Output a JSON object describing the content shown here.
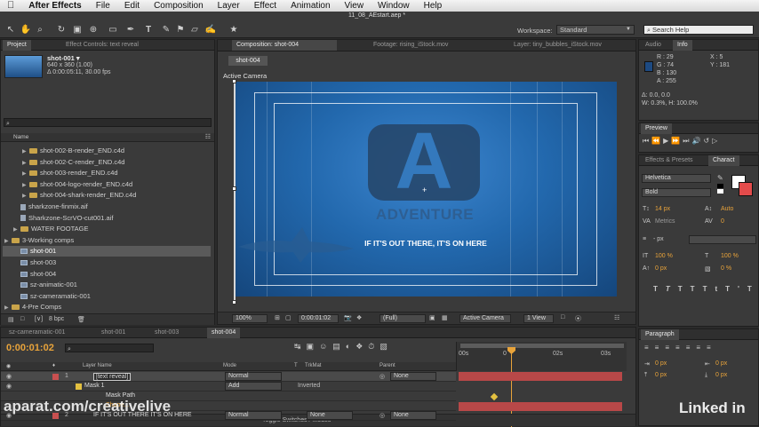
{
  "menubar": {
    "app_name": "After Effects",
    "items": [
      "File",
      "Edit",
      "Composition",
      "Layer",
      "Effect",
      "Animation",
      "View",
      "Window",
      "Help"
    ]
  },
  "toolbar": {
    "file_title": "11_08_AEstart.aep *",
    "workspace_label": "Workspace:",
    "workspace_value": "Standard",
    "search_placeholder": "Search Help"
  },
  "project": {
    "tab_project": "Project",
    "tab_effect_controls": "Effect Controls: text reveal",
    "selected_name": "shot-001 ▾",
    "selected_size": "640 x 360 (1.00)",
    "selected_duration": "Δ 0:00:05:11, 30.00 fps",
    "column_name": "Name",
    "items": [
      {
        "name": "shot-002-B-render_END.c4d",
        "type": "folder",
        "indent": 2
      },
      {
        "name": "shot-002-C-render_END.c4d",
        "type": "folder",
        "indent": 2
      },
      {
        "name": "shot-003-render_END.c4d",
        "type": "folder",
        "indent": 2
      },
      {
        "name": "shot-004-logo-render_END.c4d",
        "type": "folder",
        "indent": 2
      },
      {
        "name": "shot-004-shark-render_END.c4d",
        "type": "folder",
        "indent": 2
      },
      {
        "name": "sharkzone-finmix.aif",
        "type": "file",
        "indent": 1
      },
      {
        "name": "Sharkzone-ScrVO-cut001.aif",
        "type": "file",
        "indent": 1
      },
      {
        "name": "WATER FOOTAGE",
        "type": "folder",
        "indent": 1
      },
      {
        "name": "3-Working comps",
        "type": "folder",
        "indent": 0
      },
      {
        "name": "shot-001",
        "type": "comp",
        "indent": 1,
        "selected": true
      },
      {
        "name": "shot-003",
        "type": "comp",
        "indent": 1
      },
      {
        "name": "shot-004",
        "type": "comp",
        "indent": 1
      },
      {
        "name": "sz-animatic-001",
        "type": "comp",
        "indent": 1
      },
      {
        "name": "sz-cameramatic-001",
        "type": "comp",
        "indent": 1
      },
      {
        "name": "4-Pre Comps",
        "type": "folder",
        "indent": 0
      }
    ],
    "bpc": "8 bpc"
  },
  "composition": {
    "tab_comp": "Composition: shot-004",
    "tab_footage": "Footage: rising_iStock.mov",
    "tab_layer": "Layer: tiny_bubbles_iStock.mov",
    "subtab": "shot-004",
    "camera_label": "Active Camera",
    "logo_letter": "A",
    "brand_text": "ADVENTURE",
    "tagline": "IF IT'S OUT THERE, IT'S ON HERE",
    "zoom": "100%",
    "timecode": "0:00:01:02",
    "resolution": "(Full)",
    "camera_dropdown": "Active Camera",
    "view_dropdown": "1 View"
  },
  "info": {
    "tab_audio": "Audio",
    "tab_info": "Info",
    "r": "R : 29",
    "g": "G : 74",
    "b": "B : 130",
    "a": "A : 255",
    "x": "X : 5",
    "y": "Y : 181",
    "delta1": "Δ: 0.0, 0.0",
    "delta2": "W: 0.3%, H: 100.0%",
    "sample_color": "#1d4a82"
  },
  "preview": {
    "tab": "Preview"
  },
  "character": {
    "tab_effects": "Effects & Presets",
    "tab_character": "Charact",
    "font": "Helvetica",
    "style": "Bold",
    "size": "14 px",
    "leading": "Auto",
    "kerning": "Metrics",
    "tracking": "0",
    "stroke": "- px",
    "vscale": "100 %",
    "hscale": "100 %",
    "baseline": "0 px",
    "tsume": "0 %",
    "accent_color": "#e8a33a"
  },
  "paragraph": {
    "tab": "Paragraph",
    "indent_left": "0 px",
    "indent_right": "0 px",
    "space_before": "0 px",
    "space_after": "0 px"
  },
  "timeline": {
    "tabs": [
      "sz-cameramatic-001",
      "shot-001",
      "shot-003",
      "shot-004"
    ],
    "timecode": "0:00:01:02",
    "col_layer_name": "Layer Name",
    "col_mode": "Mode",
    "col_t": "T",
    "col_trkmat": "TrkMat",
    "col_parent": "Parent",
    "ruler": [
      "00s",
      "0",
      "02s",
      "03s"
    ],
    "layers": [
      {
        "num": "1",
        "name": "[text reveal]",
        "mode": "Normal",
        "parent": "None",
        "color": "#c85050"
      },
      {
        "num": "",
        "name": "Mask 1",
        "mode": "Add",
        "extra": "Inverted",
        "color": "#e3c040"
      },
      {
        "num": "",
        "name": "Mask Path",
        "mode": "",
        "color": ""
      },
      {
        "num": "",
        "name": "Shape...",
        "mode": "",
        "color": ""
      },
      {
        "num": "2",
        "name": "IF IT'S OUT THERE IT'S ON HERE",
        "mode": "Normal",
        "trkmat": "None",
        "parent": "None",
        "color": "#c85050"
      }
    ],
    "footer": "Toggle Switches / Modes"
  },
  "watermarks": {
    "left": "aparat.com/creativelive",
    "right": "Linked in"
  }
}
